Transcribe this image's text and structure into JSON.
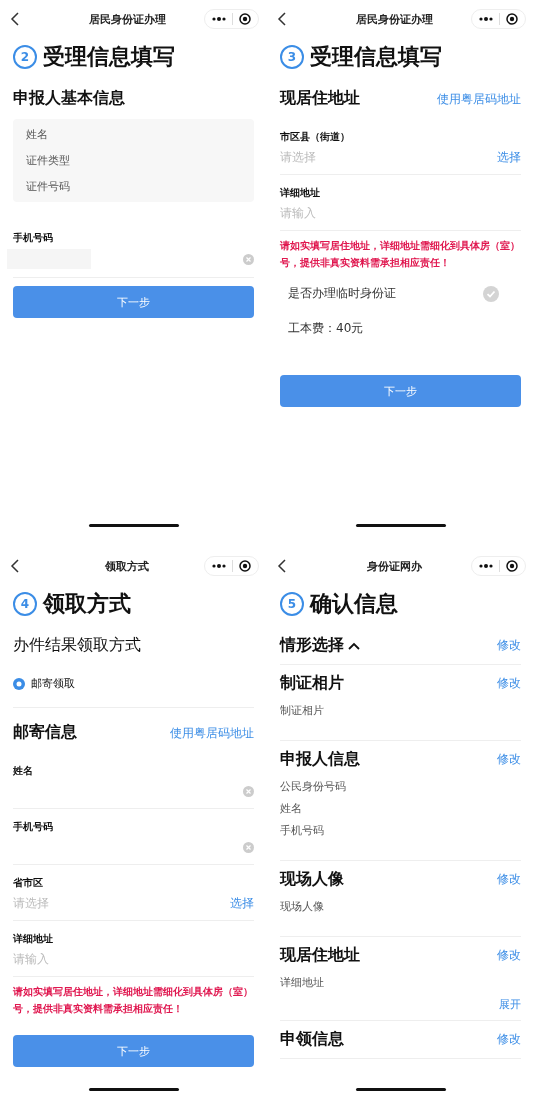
{
  "screens": [
    {
      "nav_title": "居民身份证办理",
      "step": "2",
      "title": "受理信息填写",
      "blocks": [
        {
          "kind": "heading",
          "text": "申报人基本信息"
        },
        {
          "kind": "info_card",
          "items": [
            "姓名",
            "证件类型",
            "证件号码"
          ]
        },
        {
          "kind": "field",
          "label": "手机号码",
          "filled": true,
          "clearable": true
        },
        {
          "kind": "button",
          "label": "下一步"
        }
      ]
    },
    {
      "nav_title": "居民身份证办理",
      "step": "3",
      "title": "受理信息填写",
      "blocks": [
        {
          "kind": "heading",
          "text": "现居住地址",
          "link": "使用粤居码地址"
        },
        {
          "kind": "field",
          "label": "市区县（街道）",
          "placeholder": "请选择",
          "action": "选择"
        },
        {
          "kind": "field",
          "label": "详细地址",
          "placeholder": "请输入"
        },
        {
          "kind": "warning",
          "text": "请如实填写居住地址，详细地址需细化到具体房（室）号，提供非真实资料需承担相应责任！"
        },
        {
          "kind": "check",
          "label": "是否办理临时身份证",
          "checked": false
        },
        {
          "kind": "fee",
          "text": "工本费：40元"
        },
        {
          "kind": "button",
          "label": "下一步"
        }
      ]
    },
    {
      "nav_title": "领取方式",
      "step": "4",
      "title": "领取方式",
      "blocks": [
        {
          "kind": "subheading",
          "text": "办件结果领取方式"
        },
        {
          "kind": "radio",
          "label": "邮寄领取",
          "selected": true
        },
        {
          "kind": "heading",
          "text": "邮寄信息",
          "link": "使用粤居码地址"
        },
        {
          "kind": "field",
          "label": "姓名",
          "clearable": true
        },
        {
          "kind": "field",
          "label": "手机号码",
          "clearable": true
        },
        {
          "kind": "field",
          "label": "省市区",
          "placeholder": "请选择",
          "action": "选择"
        },
        {
          "kind": "field",
          "label": "详细地址",
          "placeholder": "请输入"
        },
        {
          "kind": "warning",
          "text": "请如实填写居住地址，详细地址需细化到具体房（室）号，提供非真实资料需承担相应责任！"
        },
        {
          "kind": "button",
          "label": "下一步"
        }
      ]
    },
    {
      "nav_title": "身份证网办",
      "step": "5",
      "title": "确认信息",
      "blocks": [
        {
          "kind": "review",
          "title": "情形选择",
          "collapsible": true,
          "action": "修改"
        },
        {
          "kind": "review",
          "title": "制证相片",
          "action": "修改",
          "items": [
            "制证相片"
          ]
        },
        {
          "kind": "review",
          "title": "申报人信息",
          "action": "修改",
          "items": [
            "公民身份号码",
            "姓名",
            "手机号码"
          ]
        },
        {
          "kind": "review",
          "title": "现场人像",
          "action": "修改",
          "items": [
            "现场人像"
          ]
        },
        {
          "kind": "review",
          "title": "现居住地址",
          "action": "修改",
          "items": [
            "详细地址"
          ],
          "expand": "展开"
        },
        {
          "kind": "review",
          "title": "申领信息",
          "action": "修改"
        }
      ]
    }
  ]
}
